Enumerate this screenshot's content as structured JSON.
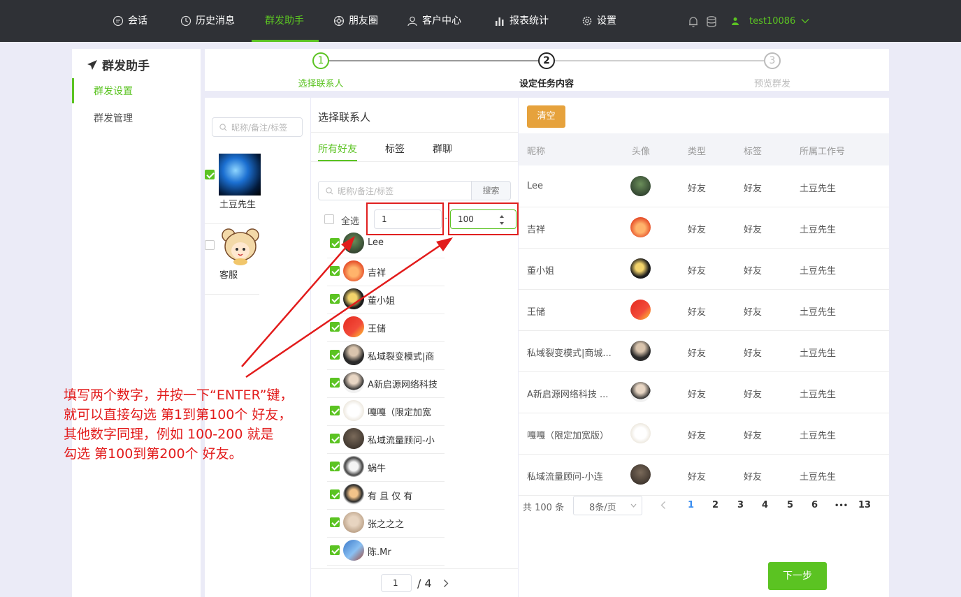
{
  "nav": {
    "items": [
      {
        "label": "会话",
        "icon": "chat-icon"
      },
      {
        "label": "历史消息",
        "icon": "clock-icon"
      },
      {
        "label": "群发助手",
        "icon": ""
      },
      {
        "label": "朋友圈",
        "icon": "moments-icon"
      },
      {
        "label": "客户中心",
        "icon": "user-icon"
      },
      {
        "label": "报表统计",
        "icon": "bar-chart-icon"
      },
      {
        "label": "设置",
        "icon": "gear-icon"
      }
    ],
    "active": "群发助手",
    "user": "test10086",
    "accent": "#5bc322"
  },
  "sidebar": {
    "title": "群发助手",
    "items": [
      {
        "label": "群发设置"
      },
      {
        "label": "群发管理"
      }
    ]
  },
  "steps": [
    {
      "num": "1",
      "label": "选择联系人",
      "state": "done"
    },
    {
      "num": "2",
      "label": "设定任务内容",
      "state": "current"
    },
    {
      "num": "3",
      "label": "预览群发",
      "state": "todo"
    }
  ],
  "accounts": {
    "search_placeholder": "昵称/备注/标签",
    "list": [
      {
        "name": "土豆先生",
        "checked": true
      },
      {
        "name": "客服",
        "checked": false
      }
    ]
  },
  "contacts": {
    "title": "选择联系人",
    "tabs": [
      "所有好友",
      "标签",
      "群聊"
    ],
    "search_placeholder": "昵称/备注/标签",
    "search_button": "搜索",
    "select_all": "全选",
    "range_from": "1",
    "range_to": "100",
    "friends": [
      {
        "name": "Lee"
      },
      {
        "name": "吉祥"
      },
      {
        "name": "董小姐"
      },
      {
        "name": "王储"
      },
      {
        "name": "私域裂变模式|商"
      },
      {
        "name": "A新启源网络科技"
      },
      {
        "name": "嘎嘎（限定加宽"
      },
      {
        "name": "私域流量顾问-小"
      },
      {
        "name": "蜗牛"
      },
      {
        "name": "有 且 仅 有"
      },
      {
        "name": "张之之之"
      },
      {
        "name": "陈.Mr"
      }
    ],
    "page_input": "1",
    "page_total": "/ 4"
  },
  "selected": {
    "clear_button": "清空",
    "columns": [
      "昵称",
      "头像",
      "类型",
      "标签",
      "所属工作号"
    ],
    "rows": [
      {
        "nickname": "Lee",
        "type": "好友",
        "tag": "好友",
        "owner": "土豆先生"
      },
      {
        "nickname": "吉祥",
        "type": "好友",
        "tag": "好友",
        "owner": "土豆先生"
      },
      {
        "nickname": "董小姐",
        "type": "好友",
        "tag": "好友",
        "owner": "土豆先生"
      },
      {
        "nickname": "王储",
        "type": "好友",
        "tag": "好友",
        "owner": "土豆先生"
      },
      {
        "nickname": "私域裂变模式|商城...",
        "type": "好友",
        "tag": "好友",
        "owner": "土豆先生"
      },
      {
        "nickname": "A新启源网络科技 ...",
        "type": "好友",
        "tag": "好友",
        "owner": "土豆先生"
      },
      {
        "nickname": "嘎嘎（限定加宽版）",
        "type": "好友",
        "tag": "好友",
        "owner": "土豆先生"
      },
      {
        "nickname": "私域流量顾问-小连",
        "type": "好友",
        "tag": "好友",
        "owner": "土豆先生"
      }
    ],
    "total": "共 100 条",
    "page_size": "8条/页",
    "pages": [
      "1",
      "2",
      "3",
      "4",
      "5",
      "6",
      "•••",
      "13"
    ],
    "current_page": "1"
  },
  "next_button": "下一步",
  "annotation": [
    "填写两个数字，并按一下“ENTER”键，",
    "就可以直接勾选 第1到第100个 好友，",
    "其他数字同理，例如 100-200 就是",
    "勾选 第100到第200个 好友。"
  ]
}
